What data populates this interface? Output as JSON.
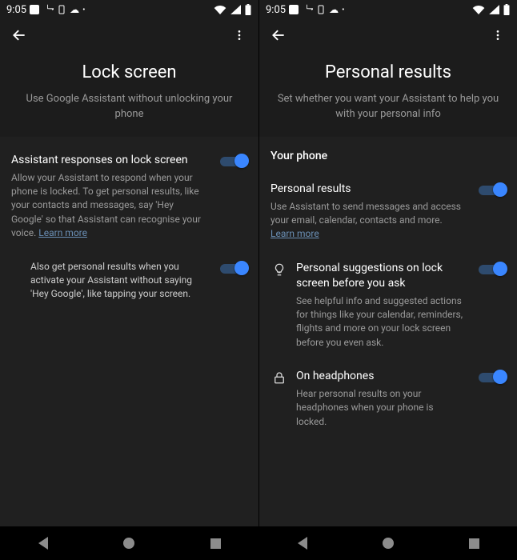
{
  "status": {
    "time": "9:05"
  },
  "left": {
    "title": "Lock screen",
    "subtitle": "Use Google Assistant without unlocking your phone",
    "s1_title": "Assistant responses on lock screen",
    "s1_desc": "Allow your Assistant to respond when your phone is locked. To get personal results, like your contacts and messages, say 'Hey Google' so that Assistant can recognise your voice. ",
    "learn": "Learn more",
    "s2_desc": "Also get personal results when you activate your Assistant without saying 'Hey Google', like tapping your screen."
  },
  "right": {
    "title": "Personal results",
    "subtitle": "Set whether you want your Assistant to help you with your personal info",
    "section": "Your phone",
    "s1_title": "Personal results",
    "s1_desc": "Use Assistant to send messages and access your email, calendar, contacts and more. ",
    "learn": "Learn more",
    "s2_title": "Personal suggestions on lock screen before you ask",
    "s2_desc": "See helpful info and suggested actions for things like your calendar, reminders, flights and more on your lock screen before you even ask.",
    "s3_title": "On headphones",
    "s3_desc": "Hear personal results on your headphones when your phone is locked."
  }
}
